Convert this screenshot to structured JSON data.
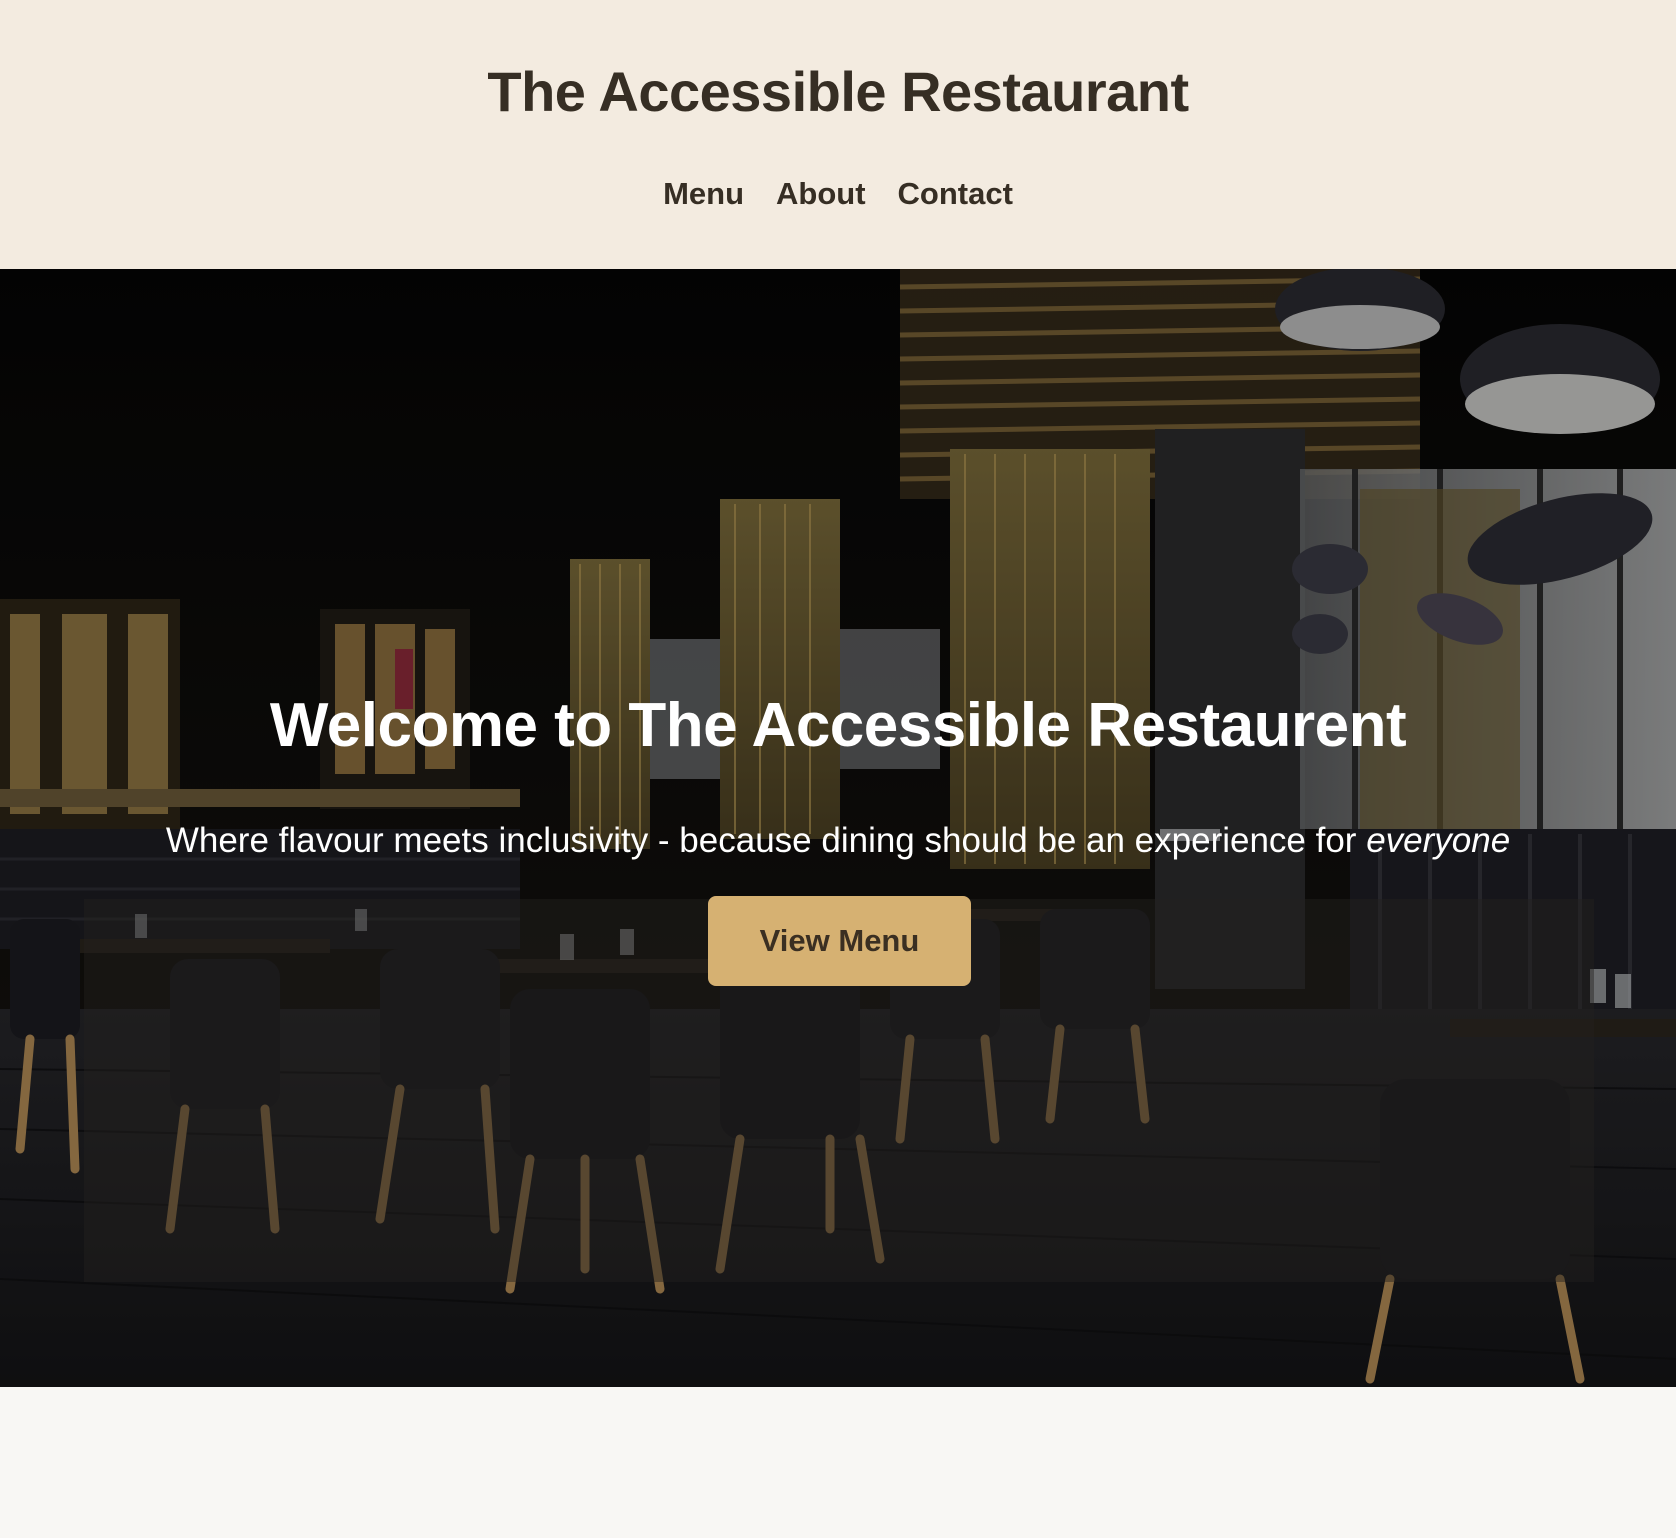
{
  "header": {
    "title": "The Accessible Restaurant",
    "nav": [
      {
        "label": "Menu"
      },
      {
        "label": "About"
      },
      {
        "label": "Contact"
      }
    ]
  },
  "hero": {
    "image": "restaurant-interior-photo",
    "heading": "Welcome to The Accessible Restaurent",
    "tagline_main": "Where flavour meets inclusivity - because dining should be an experience for ",
    "tagline_emphasis": "everyone",
    "cta_label": "View Menu"
  },
  "colors": {
    "header_bg": "#f3ebe0",
    "header_text": "#362e24",
    "button_bg": "#d6b172",
    "button_text": "#3a2f22",
    "page_bg": "#f8f7f4"
  }
}
